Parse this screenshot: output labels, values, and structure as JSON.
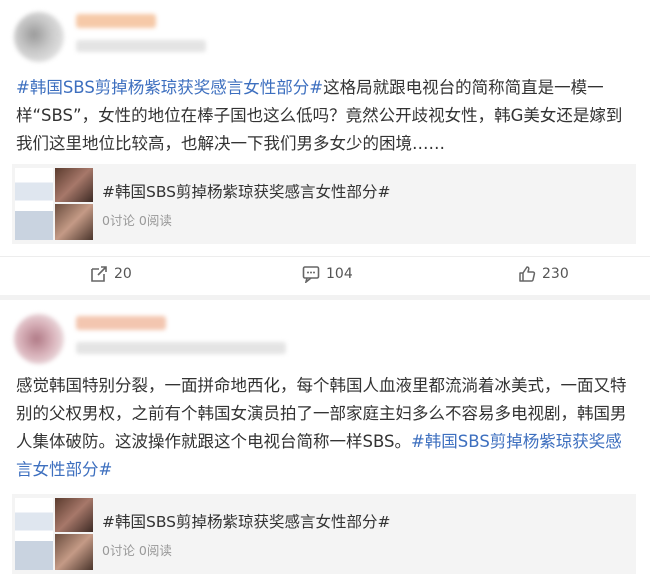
{
  "posts": [
    {
      "hashtag": "#韩国SBS剪掉杨紫琼获奖感言女性部分#",
      "body": "这格局就跟电视台的简称简直是一模一样“SBS”，女性的地位在棒子国也这么低吗？竟然公开歧视女性，韩G美女还是嫁到我们这里地位比较高，也解决一下我们男多女少的困境……",
      "card": {
        "title": "#韩国SBS剪掉杨紫琼获奖感言女性部分#",
        "meta": "0讨论 0阅读"
      },
      "actions": {
        "share": "20",
        "comment": "104",
        "like": "230"
      }
    },
    {
      "body": "感觉韩国特别分裂，一面拼命地西化，每个韩国人血液里都流淌着冰美式，一面又特别的父权男权，之前有个韩国女演员拍了一部家庭主妇多么不容易多电视剧，韩国男人集体破防。这波操作就跟这个电视台简称一样SBS。",
      "hashtag": "#韩国SBS剪掉杨紫琼获奖感言女性部分#",
      "card": {
        "title": "#韩国SBS剪掉杨紫琼获奖感言女性部分#",
        "meta": "0讨论 0阅读"
      }
    }
  ],
  "colors": {
    "hashtag": "#3d6fbf",
    "card_bg": "#f4f4f4",
    "meta": "#999999"
  },
  "icons": {
    "share": "share-icon",
    "comment": "comment-icon",
    "like": "thumbs-up-icon"
  }
}
